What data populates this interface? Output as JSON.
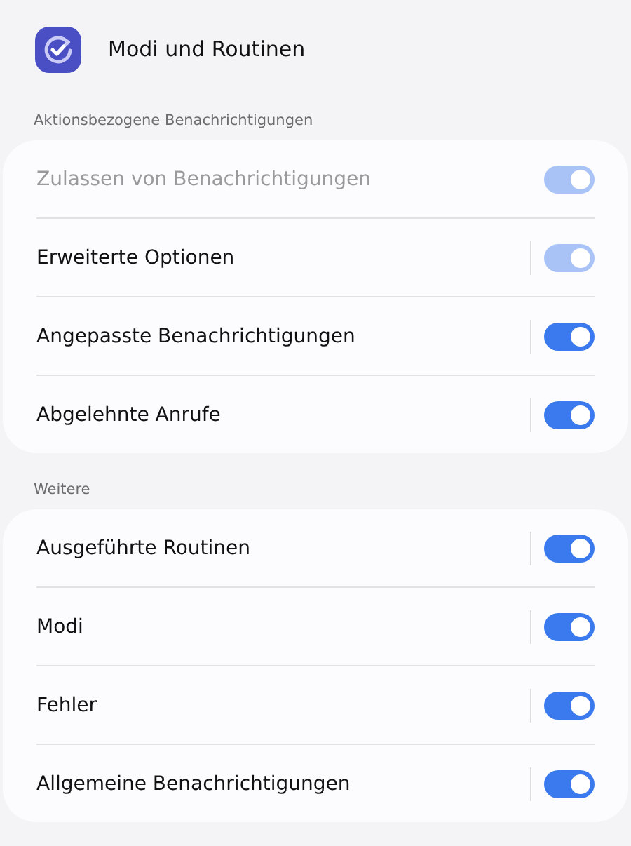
{
  "header": {
    "title": "Modi und Routinen"
  },
  "sections": [
    {
      "title": "Aktionsbezogene Benachrichtigungen",
      "rows": [
        {
          "label": "Zulassen von Benachrichtigungen",
          "kind": "switch",
          "on": true,
          "disabled": true,
          "label_dimmed": true
        },
        {
          "label": "Erweiterte Optionen",
          "kind": "split-switch",
          "on": true,
          "disabled": true,
          "label_dimmed": false
        },
        {
          "label": "Angepasste Benachrichtigungen",
          "kind": "split-switch",
          "on": true,
          "disabled": false,
          "label_dimmed": false
        },
        {
          "label": "Abgelehnte Anrufe",
          "kind": "split-switch",
          "on": true,
          "disabled": false,
          "label_dimmed": false
        }
      ]
    },
    {
      "title": "Weitere",
      "rows": [
        {
          "label": "Ausgeführte Routinen",
          "kind": "split-switch",
          "on": true,
          "disabled": false,
          "label_dimmed": false
        },
        {
          "label": "Modi",
          "kind": "split-switch",
          "on": true,
          "disabled": false,
          "label_dimmed": false
        },
        {
          "label": "Fehler",
          "kind": "split-switch",
          "on": true,
          "disabled": false,
          "label_dimmed": false
        },
        {
          "label": "Allgemeine Benachrichtigungen",
          "kind": "split-switch",
          "on": true,
          "disabled": false,
          "label_dimmed": false
        }
      ]
    }
  ]
}
